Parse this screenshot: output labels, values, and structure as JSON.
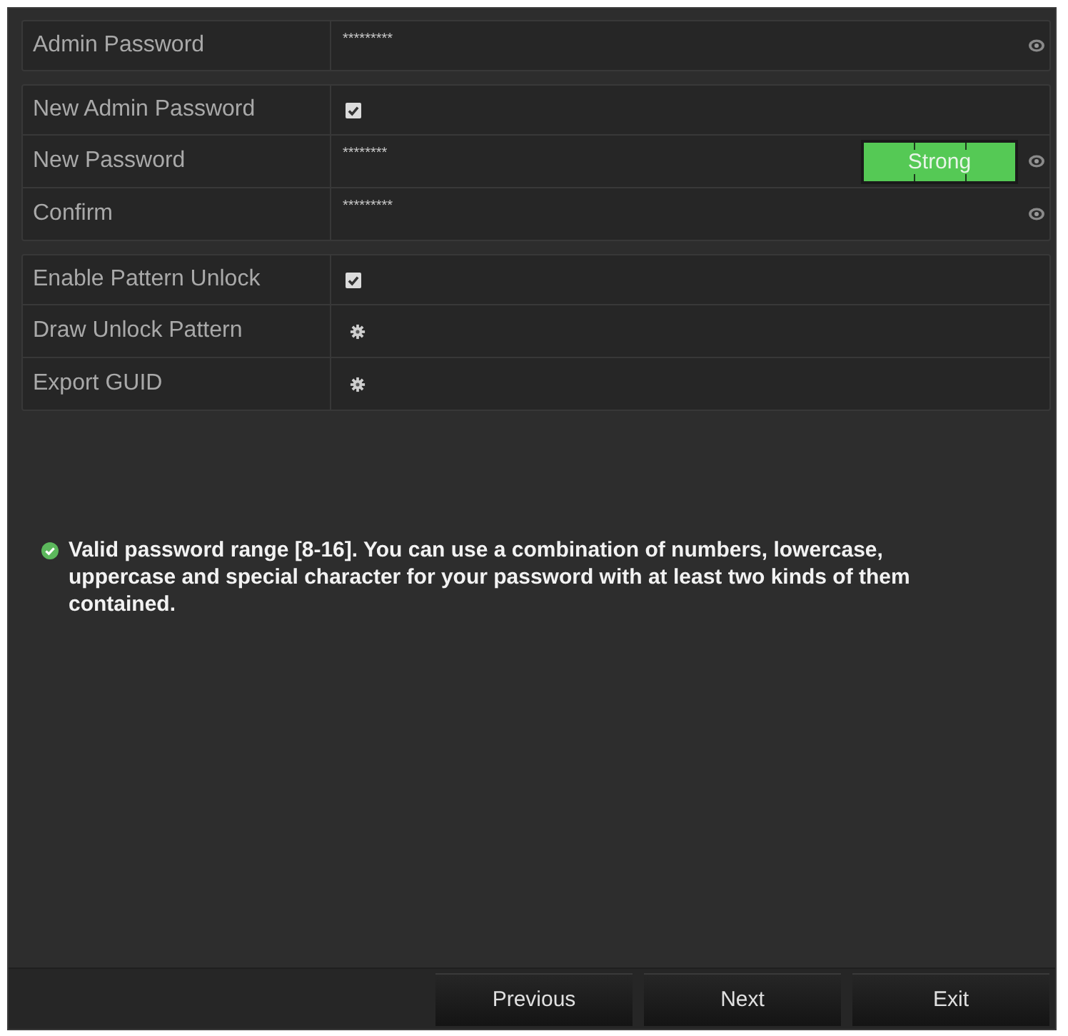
{
  "groups": [
    {
      "rows": [
        {
          "kind": "password",
          "label": "Admin Password",
          "value": "*********"
        }
      ]
    },
    {
      "rows": [
        {
          "kind": "checkbox",
          "label": "New Admin Password",
          "checked": true
        },
        {
          "kind": "password",
          "label": "New Password",
          "value": "********",
          "strength": {
            "label": "Strong",
            "level": 1
          }
        },
        {
          "kind": "password",
          "label": "Confirm",
          "value": "*********"
        }
      ]
    },
    {
      "rows": [
        {
          "kind": "checkbox",
          "label": "Enable Pattern Unlock",
          "checked": true
        },
        {
          "kind": "action",
          "label": "Draw Unlock Pattern"
        },
        {
          "kind": "action",
          "label": "Export GUID"
        }
      ]
    }
  ],
  "hint": {
    "text": "Valid password range [8-16]. You can use a combination of numbers, lowercase, uppercase and special character for your password with at least two kinds of them contained."
  },
  "buttons": [
    {
      "label": "Previous"
    },
    {
      "label": "Next"
    },
    {
      "label": "Exit"
    }
  ]
}
